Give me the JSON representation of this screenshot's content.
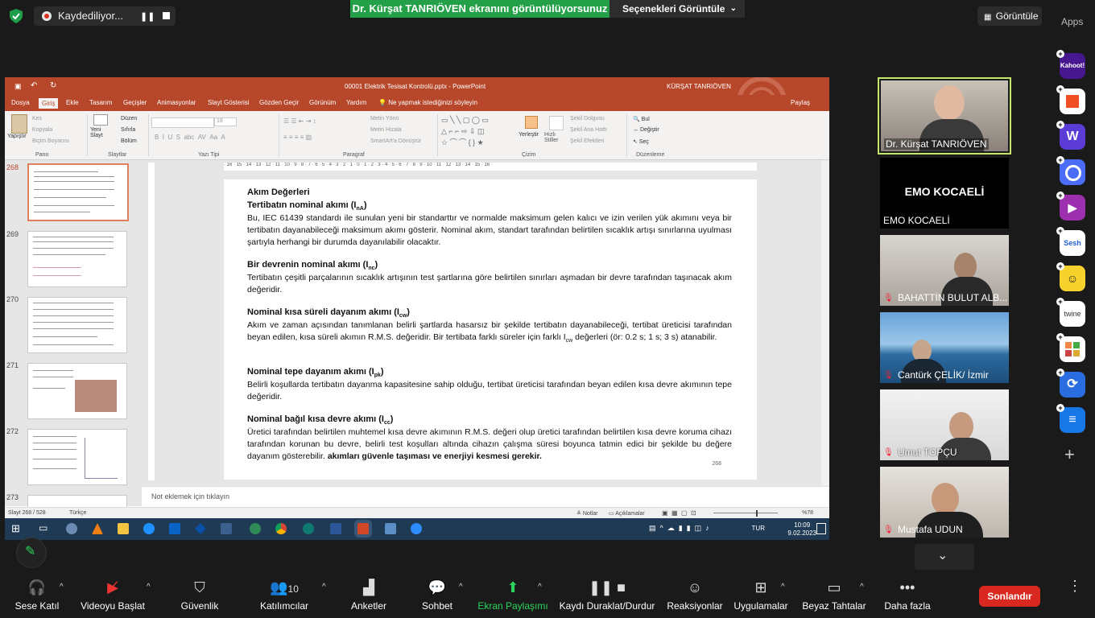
{
  "topbar": {
    "recording_label": "Kaydediliyor...",
    "share_banner": "Dr. Kürşat TANRIÖVEN ekranını görüntülüyorsunuz",
    "view_options": "Seçenekleri Görüntüle",
    "view_button": "Görüntüle",
    "apps_label": "Apps"
  },
  "powerpoint": {
    "title": "00001 Elektrik Tesisat Kontrolü.pptx - PowerPoint",
    "user": "KÜRŞAT TANRIÖVEN",
    "tabs": [
      "Dosya",
      "Giriş",
      "Ekle",
      "Tasarım",
      "Geçişler",
      "Animasyonlar",
      "Slayt Gösterisi",
      "Gözden Geçir",
      "Görünüm",
      "Yardım"
    ],
    "tell_me": "Ne yapmak istediğinizi söyleyin",
    "share": "Paylaş",
    "ribbon": {
      "paste": "Yapıştır",
      "cut": "Kes",
      "copy": "Kopyala",
      "format_painter": "Biçim Boyacısı",
      "group_clipboard": "Pano",
      "new_slide": "Yeni Slayt",
      "layout": "Düzen",
      "reset": "Sıfırla",
      "section": "Bölüm",
      "group_slides": "Slaytlar",
      "font_size": "18",
      "group_font": "Yazı Tipi",
      "text_direction": "Metin Yönü",
      "align_text": "Metin Hizala",
      "smartart": "SmartArt'a Dönüştür",
      "group_paragraph": "Paragraf",
      "arrange": "Yerleştir",
      "quick_styles": "Hızlı Stiller",
      "shape_fill": "Şekil Dolgusu",
      "shape_outline": "Şekil Ana Hattı",
      "shape_effects": "Şekil Efektleri",
      "group_drawing": "Çizim",
      "find": "Bul",
      "replace": "Değiştir",
      "select": "Seç",
      "group_editing": "Düzenleme"
    },
    "ruler": "· 16 · 15 · 14 · 13 · 12 · 11 · 10 · 9 · 8 · 7 · 6 · 5 · 4 · 3 · 2 · 1 · 0 · 1 · 2 · 3 · 4 · 5 · 6 · 7 · 8 · 9 · 10 · 11 · 12 · 13 · 14 · 15 · 16 ·",
    "thumbnails": [
      "268",
      "269",
      "270",
      "271",
      "272",
      "273"
    ],
    "slide": {
      "heading": "Akım Değerleri",
      "s1_title": "Tertibatın nominal akımı (I",
      "s1_sub": "nA",
      "s1_text": "Bu, IEC 61439 standardı ile sunulan yeni bir standarttır ve normalde maksimum gelen kalıcı ve izin verilen yük akımını veya bir tertibatın dayanabileceği maksimum akımı gösterir. Nominal akım, standart tarafından belirtilen sıcaklık artışı sınırlarına uyulması şartıyla herhangi bir durumda dayanılabilir olacaktır.",
      "s2_title": "Bir devrenin nominal akımı (I",
      "s2_sub": "nc",
      "s2_text": "Tertibatın çeşitli parçalarının sıcaklık artışının test şartlarına göre belirtilen sınırları aşmadan bir devre tarafından taşınacak akım değeridir.",
      "s3_title": "Nominal kısa süreli dayanım akımı (I",
      "s3_sub": "cw",
      "s3_text_a": "Akım ve zaman açısından tanımlanan belirli şartlarda hasarsız bir şekilde tertibatın dayanabileceği, tertibat üreticisi tarafından beyan edilen, kısa süreli akımın R.M.S. değeridir. Bir tertibata farklı süreler için farklı I",
      "s3_text_sub": "cw",
      "s3_text_b": " değerleri (ör: 0.2 s; 1 s; 3 s) atanabilir.",
      "s4_title": "Nominal tepe dayanım akımı (I",
      "s4_sub": "pk",
      "s4_text": "Belirli koşullarda tertibatın dayanma kapasitesine sahip olduğu, tertibat üreticisi tarafından beyan edilen kısa devre akımının tepe değeridir.",
      "s5_title": "Nominal bağıl kısa devre akımı (I",
      "s5_sub": "cc",
      "s5_text": "Üretici tarafından belirtilen muhtemel kısa devre akımının R.M.S. değeri olup üretici tarafından belirtilen kısa devre koruma cihazı tarafından korunan bu devre, belirli test koşulları altında cihazın çalışma süresi boyunca tatmin edici bir şekilde bu değere dayanım gösterebilir.",
      "s5_bold": "akımları güvenle taşıması ve enerjiyi  kesmesi  gerekir.",
      "page_number": "268"
    },
    "notes_placeholder": "Not eklemek için tıklayın",
    "status": {
      "slide_count": "Slayt 268 / 528",
      "language": "Türkçe",
      "notes": "Notlar",
      "comments": "Açıklamalar",
      "zoom": "%78"
    },
    "taskbar": {
      "language": "TUR",
      "time": "10:09",
      "date": "9.02.2023"
    }
  },
  "participants": {
    "active_speaker": "Dr. Kürşat TANRIÖVEN",
    "emo_big": "EMO KOCAELİ",
    "emo_small": "EMO KOCAELİ",
    "others": [
      "BAHATTİN BULUT ALB...",
      "Cantürk ÇELİK/ İzmir",
      "Umut TOPÇU",
      "Mustafa UDUN"
    ]
  },
  "apps": [
    "Kahoot!",
    "Sesh",
    "twine"
  ],
  "toolbar": {
    "audio": "Sese Katıl",
    "video": "Videoyu Başlat",
    "security": "Güvenlik",
    "participants": "Katılımcılar",
    "participants_count": "10",
    "polls": "Anketler",
    "chat": "Sohbet",
    "share": "Ekran Paylaşımı",
    "record": "Kaydı Duraklat/Durdur",
    "reactions": "Reaksiyonlar",
    "apps": "Uygulamalar",
    "whiteboards": "Beyaz Tahtalar",
    "more": "Daha fazla",
    "end": "Sonlandır"
  },
  "colors": {
    "ppt_accent": "#b7472a",
    "share_green": "#24a148",
    "end_red": "#d9281f",
    "speaker_border": "#c8e66a"
  }
}
